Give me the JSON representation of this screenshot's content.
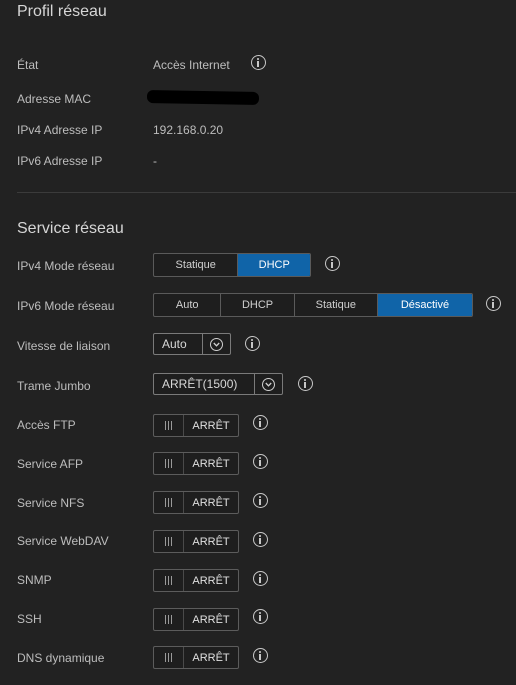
{
  "profile": {
    "title": "Profil réseau",
    "rows": [
      {
        "label": "État",
        "value": "Accès Internet"
      },
      {
        "label": "Adresse MAC",
        "value": ""
      },
      {
        "label": "IPv4 Adresse IP",
        "value": "192.168.0.20"
      },
      {
        "label": "IPv6 Adresse IP",
        "value": "-"
      }
    ]
  },
  "service": {
    "title": "Service réseau",
    "ipv4": {
      "label": "IPv4 Mode réseau",
      "options": [
        "Statique",
        "DHCP"
      ],
      "selected": "DHCP"
    },
    "ipv6": {
      "label": "IPv6 Mode réseau",
      "options": [
        "Auto",
        "DHCP",
        "Statique",
        "Désactivé"
      ],
      "selected": "Désactivé"
    },
    "link_speed": {
      "label": "Vitesse de liaison",
      "value": "Auto"
    },
    "jumbo": {
      "label": "Trame Jumbo",
      "value": "ARRÊT(1500)"
    },
    "toggles": [
      {
        "label": "Accès FTP",
        "state": "ARRÊT"
      },
      {
        "label": "Service AFP",
        "state": "ARRÊT"
      },
      {
        "label": "Service NFS",
        "state": "ARRÊT"
      },
      {
        "label": "Service WebDAV",
        "state": "ARRÊT"
      },
      {
        "label": "SNMP",
        "state": "ARRÊT"
      },
      {
        "label": "SSH",
        "state": "ARRÊT"
      },
      {
        "label": "DNS dynamique",
        "state": "ARRÊT"
      }
    ]
  },
  "colors": {
    "background": "#222222",
    "accent": "#1064a8",
    "text": "#c9c9c9"
  },
  "icons": {
    "info": "info-circle-icon",
    "dropdown": "chevron-down-icon",
    "grip": "toggle-grip-icon"
  }
}
